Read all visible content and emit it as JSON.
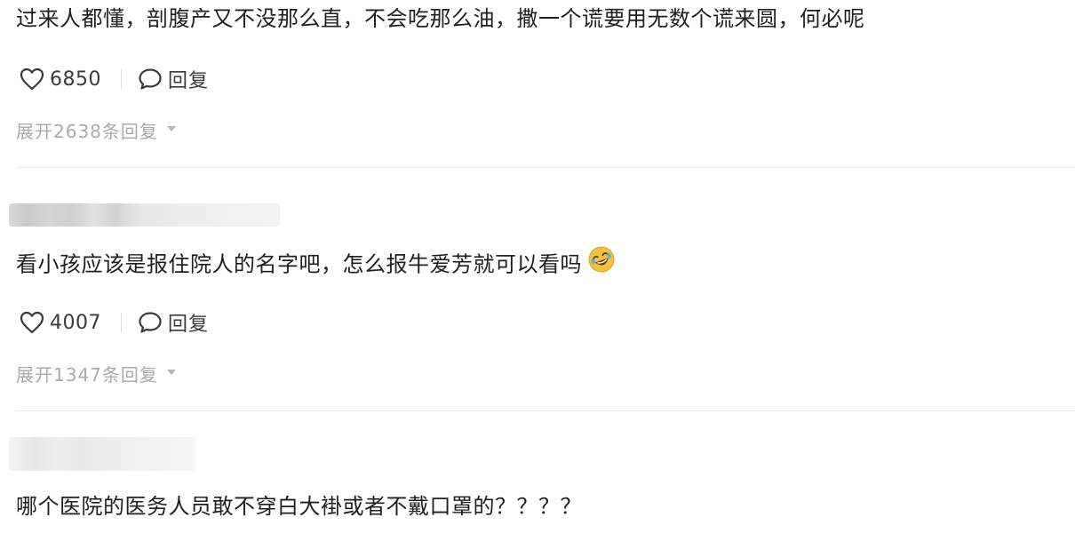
{
  "comments": [
    {
      "username": "",
      "text": "过来人都懂，剖腹产又不没那么直，不会吃那么油，撒一个谎要用无数个谎来圆，何必呢",
      "likes": "6850",
      "reply_label": "回复",
      "expand_label": "展开2638条回复"
    },
    {
      "username": "",
      "text": "看小孩应该是报住院人的名字吧，怎么报牛爱芳就可以看吗",
      "emoji": "rolling-on-floor-laughing-emoji",
      "likes": "4007",
      "reply_label": "回复",
      "expand_label": "展开1347条回复"
    },
    {
      "username": "",
      "text": "哪个医院的医务人员敢不穿白大褂或者不戴口罩的？？？？"
    }
  ],
  "icons": {
    "like": "heart-outline-icon",
    "reply": "speech-bubble-icon",
    "expand": "caret-down-icon"
  },
  "colors": {
    "text": "#1f1f1f",
    "action": "#3a3a3a",
    "muted": "#a9a9a9",
    "divider": "#ececec",
    "emoji_face": "#f5c33b"
  }
}
